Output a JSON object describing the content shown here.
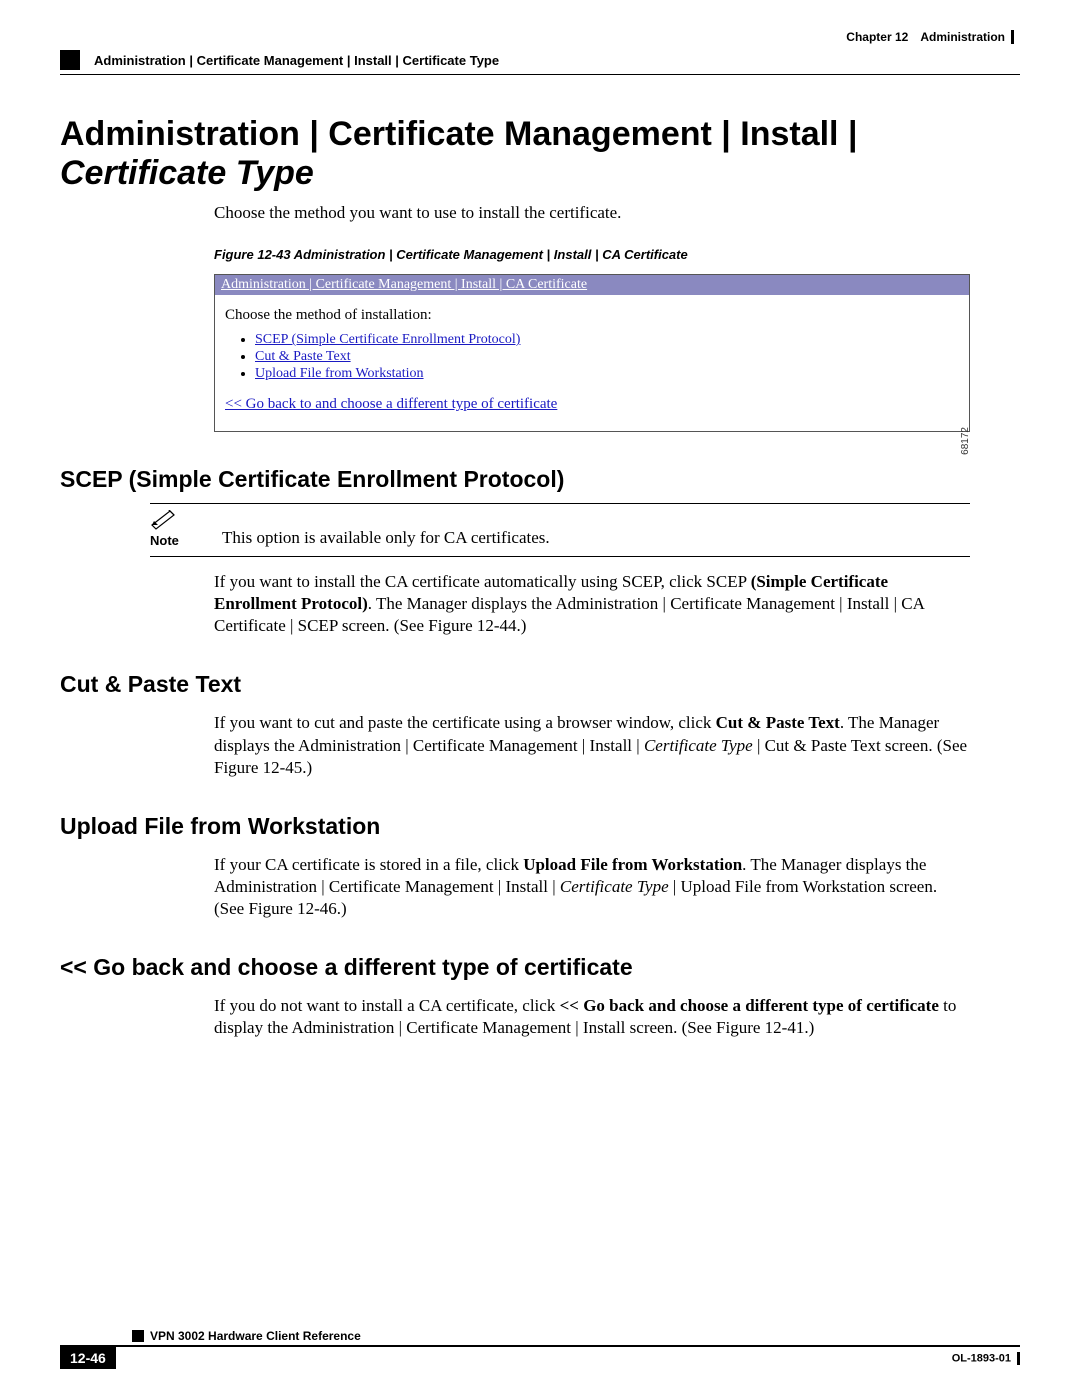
{
  "header": {
    "chapter": "Chapter 12",
    "section": "Administration",
    "breadcrumb": "Administration | Certificate Management | Install | Certificate Type"
  },
  "title": {
    "plain": "Administration | Certificate Management | Install | ",
    "italic": "Certificate Type"
  },
  "intro": "Choose the method you want to use to install the certificate.",
  "figure": {
    "caption": "Figure 12-43 Administration | Certificate Management | Install | CA Certificate",
    "titlebar": "Administration | Certificate Management | Install | CA Certificate",
    "prompt": "Choose the method of installation:",
    "options": [
      "SCEP (Simple Certificate Enrollment Protocol)",
      "Cut & Paste Text",
      "Upload File from Workstation"
    ],
    "back_link": "<< Go back to and choose a different type of certificate",
    "id": "68172"
  },
  "sections": {
    "scep": {
      "heading": "SCEP (Simple Certificate Enrollment Protocol)",
      "note_label": "Note",
      "note_text": "This option is available only for CA certificates.",
      "para_pre": "If you want to install the CA certificate automatically using SCEP, click SCEP ",
      "para_bold": "(Simple Certificate Enrollment Protocol)",
      "para_post": ". The Manager displays the Administration | Certificate Management | Install | CA Certificate | SCEP screen. (See Figure 12-44.)"
    },
    "cut": {
      "heading": "Cut & Paste Text",
      "p1": "If you want to cut and paste the certificate using a browser window, click ",
      "p1_bold": "Cut & Paste Text",
      "p1_mid": ". The Manager displays the Administration | Certificate Management | Install | ",
      "p1_italic": "Certificate Type",
      "p1_end": " | Cut & Paste Text screen. (See Figure 12-45.)"
    },
    "upload": {
      "heading": "Upload File from Workstation",
      "p1": "If your CA certificate is stored in a file, click ",
      "p1_bold": "Upload File from Workstation",
      "p1_mid": ". The Manager displays the Administration | Certificate Management | Install | ",
      "p1_italic": "Certificate Type",
      "p1_end": " | Upload File from Workstation screen. (See Figure 12-46.)"
    },
    "back": {
      "heading": "<< Go back and choose a different type of certificate",
      "p1": "If you do not want to install a CA certificate, click ",
      "p1_bold": "<< Go back and choose a different type of certificate",
      "p1_end": " to display the Administration | Certificate Management | Install screen. (See Figure 12-41.)"
    }
  },
  "footer": {
    "doc_title": "VPN 3002 Hardware Client Reference",
    "page_num": "12-46",
    "doc_id": "OL-1893-01"
  }
}
